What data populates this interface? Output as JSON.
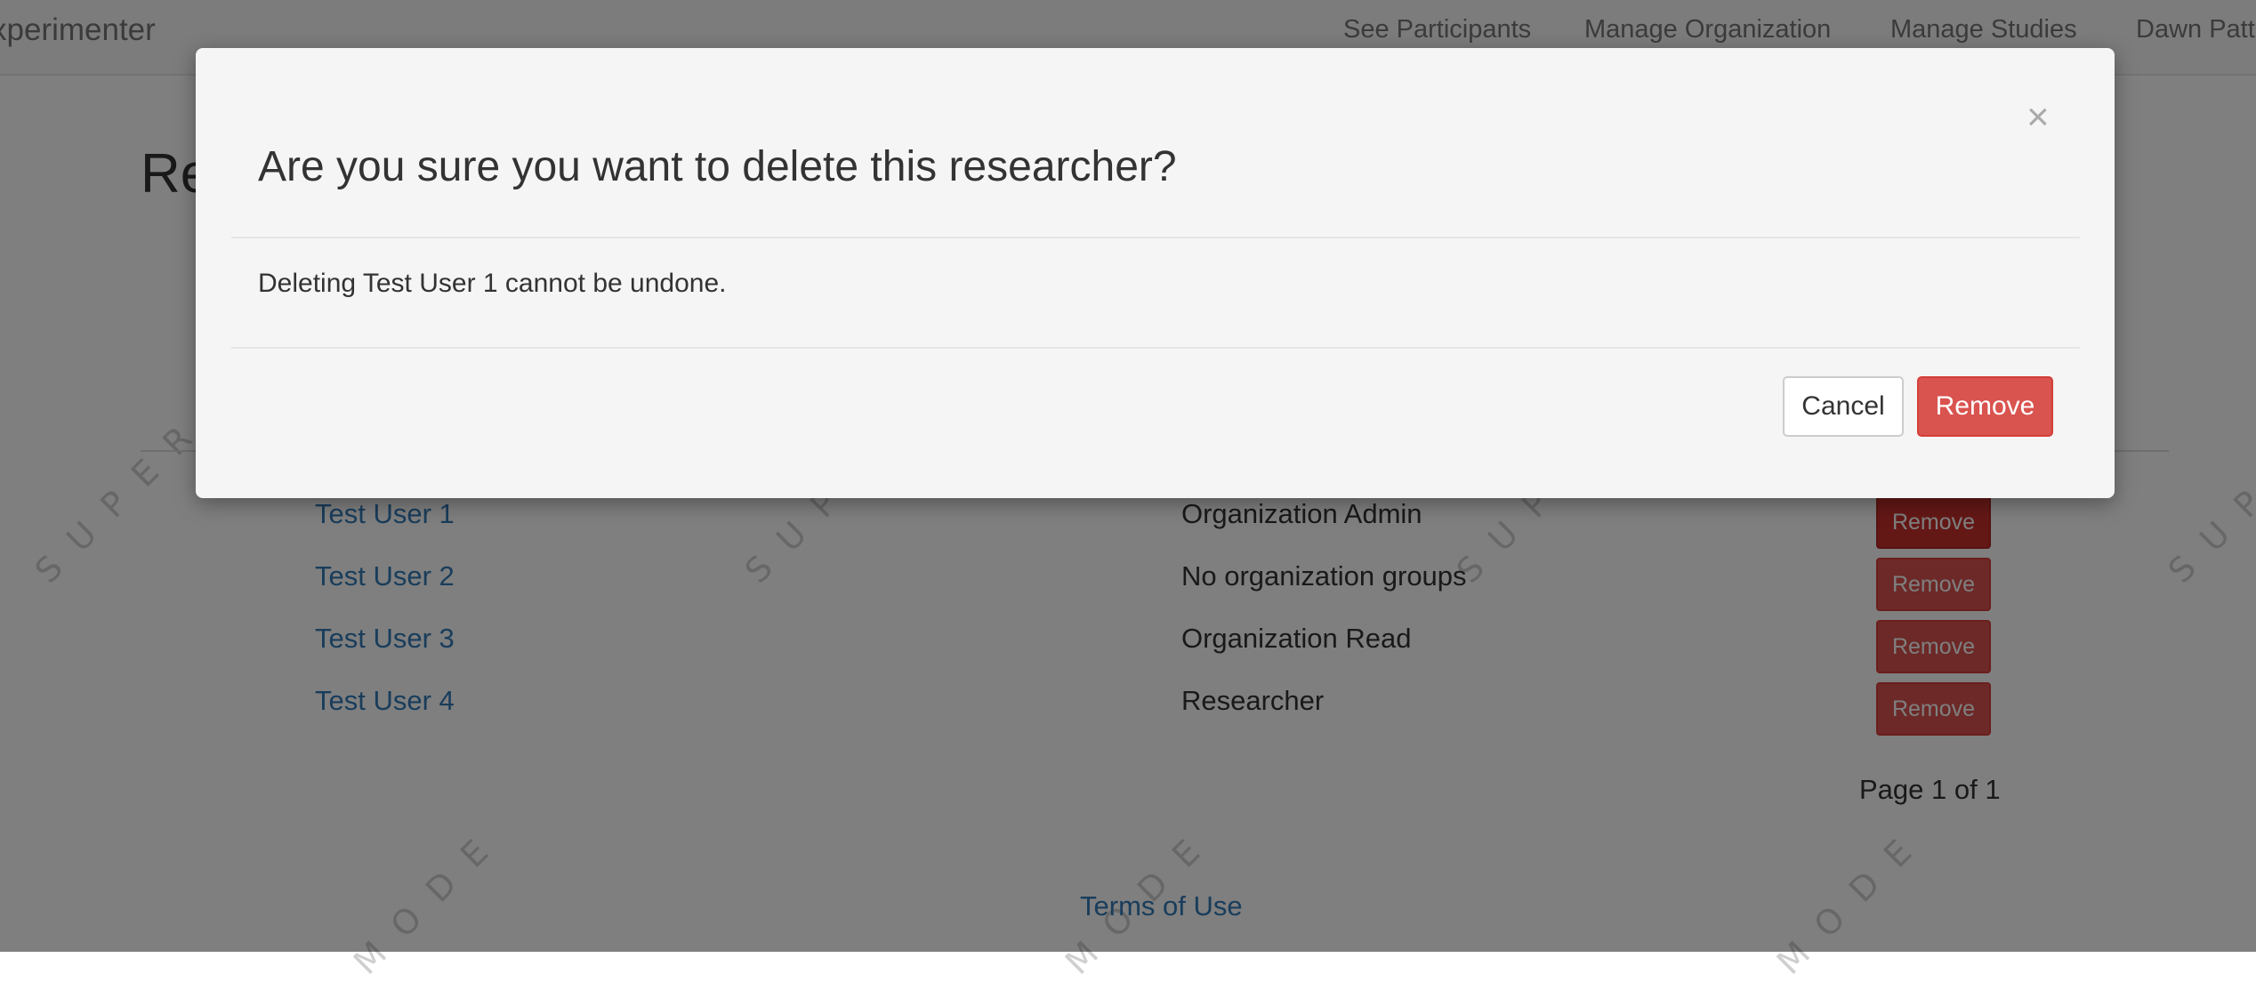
{
  "navbar": {
    "brand": "xperimenter",
    "links": [
      "See Participants",
      "Manage Organization",
      "Manage Studies",
      "Dawn Patt"
    ]
  },
  "page": {
    "title": "Re"
  },
  "researchers": [
    {
      "name": "Test User 1",
      "role": "Organization Admin",
      "action": "Remove"
    },
    {
      "name": "Test User 2",
      "role": "No organization groups",
      "action": "Remove"
    },
    {
      "name": "Test User 3",
      "role": "Organization Read",
      "action": "Remove"
    },
    {
      "name": "Test User 4",
      "role": "Researcher",
      "action": "Remove"
    }
  ],
  "pagination": "Page 1 of 1",
  "footer": {
    "terms_label": "Terms of Use"
  },
  "watermark": {
    "a": "SUPER",
    "b": "MODE"
  },
  "modal": {
    "title": "Are you sure you want to delete this researcher?",
    "close_glyph": "×",
    "body": "Deleting Test User 1 cannot be undone.",
    "cancel_label": "Cancel",
    "remove_label": "Remove"
  },
  "colors": {
    "link": "#337ab7",
    "danger": "#d9534f",
    "backdrop": "rgba(0,0,0,0.5)"
  }
}
